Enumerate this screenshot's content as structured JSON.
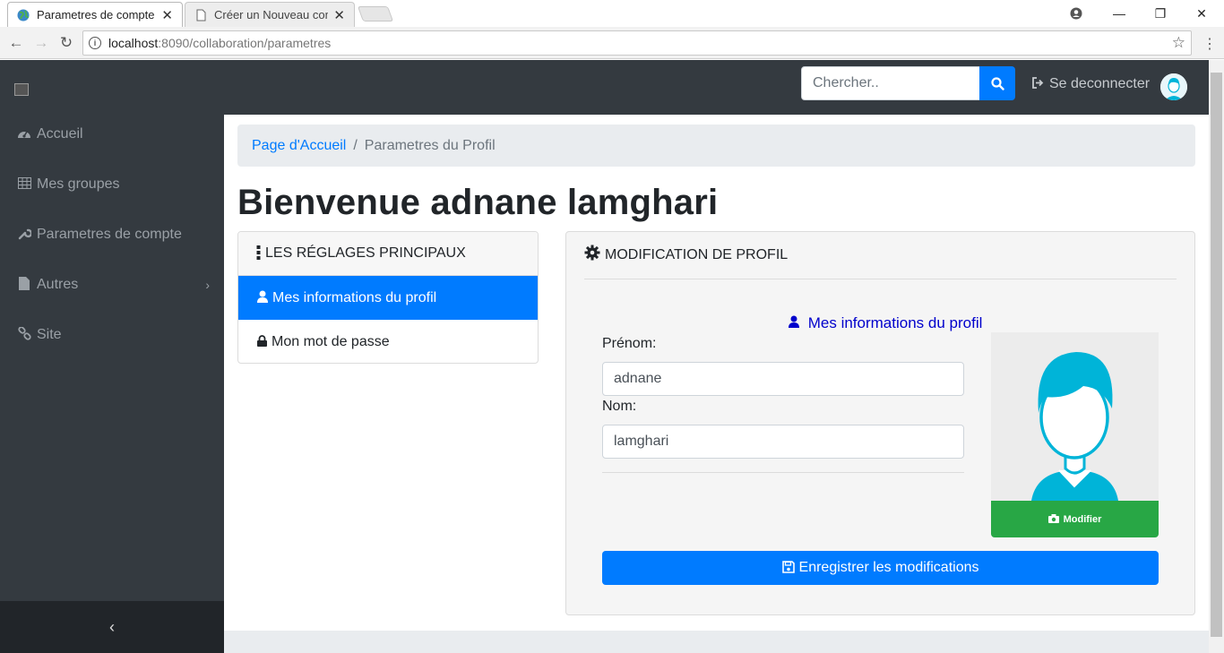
{
  "browser": {
    "tabs": [
      {
        "title": "Parametres de compte",
        "active": true
      },
      {
        "title": "Créer un Nouveau compt",
        "active": false
      }
    ],
    "url_host": "localhost",
    "url_path": ":8090/collaboration/parametres",
    "window_controls": {
      "minimize": "—",
      "maximize": "❐",
      "close": "✕"
    }
  },
  "sidebar": {
    "items": [
      {
        "label": "Accueil",
        "icon": "dashboard-icon"
      },
      {
        "label": "Mes groupes",
        "icon": "table-icon"
      },
      {
        "label": "Parametres de compte",
        "icon": "wrench-icon"
      },
      {
        "label": "Autres",
        "icon": "file-icon",
        "has_submenu": true
      },
      {
        "label": "Site",
        "icon": "link-icon"
      }
    ],
    "collapse_glyph": "‹"
  },
  "topbar": {
    "search_placeholder": "Chercher..",
    "logout_label": "Se deconnecter"
  },
  "breadcrumb": {
    "home": "Page d'Accueil",
    "separator": "/",
    "current": "Parametres du Profil"
  },
  "page": {
    "welcome": "Bienvenue adnane lamghari"
  },
  "settings_menu": {
    "header": "LES RÉGLAGES PRINCIPAUX",
    "items": [
      {
        "label": "Mes informations du profil",
        "active": true
      },
      {
        "label": "Mon mot de passe",
        "active": false
      }
    ]
  },
  "profile_panel": {
    "header": "MODIFICATION DE PROFIL",
    "subtitle": "Mes informations du profil",
    "first_name_label": "Prénom:",
    "first_name_value": "adnane",
    "last_name_label": "Nom:",
    "last_name_value": "lamghari",
    "photo_button": "Modifier",
    "save_button": "Enregistrer les modifications"
  },
  "colors": {
    "primary": "#007bff",
    "success": "#28a745",
    "sidebar_bg": "#343a40",
    "avatar_accent": "#00b4d8"
  }
}
